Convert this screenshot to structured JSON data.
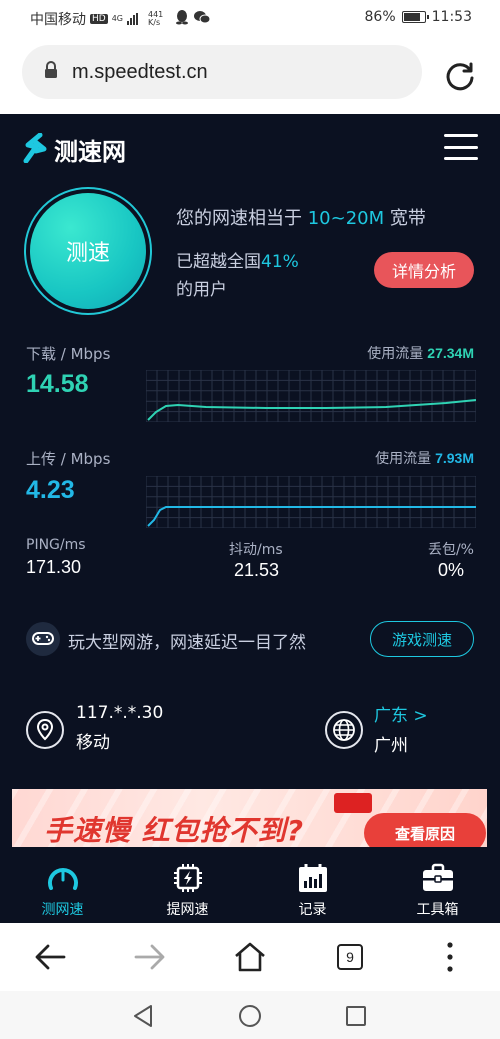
{
  "status_bar": {
    "carrier": "中国移动",
    "hd": "HD",
    "network": "4G",
    "speed_value": "441",
    "speed_unit": "K/s",
    "battery": "86%",
    "battery_level": 0.86,
    "time": "11:53"
  },
  "browser": {
    "url": "m.speedtest.cn",
    "tab_count": "9"
  },
  "app": {
    "logo": "测速网",
    "speed_button": "测速",
    "summary_prefix": "您的网速相当于",
    "summary_range": "10~20M",
    "summary_suffix": "宽带",
    "beat_prefix": "已超越全国",
    "beat_percent": "41%",
    "beat_suffix": "的用户",
    "detail_button": "详情分析"
  },
  "download": {
    "label": "下载 / Mbps",
    "value": "14.58",
    "usage_label": "使用流量",
    "usage_value": "27.34M",
    "color": "#2fd3b4"
  },
  "upload": {
    "label": "上传 / Mbps",
    "value": "4.23",
    "usage_label": "使用流量",
    "usage_value": "7.93M",
    "color": "#22b8e6"
  },
  "stats": {
    "ping_label": "PING/ms",
    "ping_value": "171.30",
    "jitter_label": "抖动/ms",
    "jitter_value": "21.53",
    "loss_label": "丢包/%",
    "loss_value": "0%"
  },
  "game": {
    "text": "玩大型网游，网速延迟一目了然",
    "button": "游戏测速"
  },
  "location": {
    "ip": "117.*.*.30",
    "isp": "移动",
    "province": "广东 >",
    "city": "广州"
  },
  "banner": {
    "text": "手速慢 红包抢不到?",
    "button": "查看原因"
  },
  "nav": {
    "items": [
      {
        "label": "测网速",
        "icon": "speedometer-icon",
        "active": true
      },
      {
        "label": "提网速",
        "icon": "chip-icon",
        "active": false
      },
      {
        "label": "记录",
        "icon": "records-icon",
        "active": false
      },
      {
        "label": "工具箱",
        "icon": "toolbox-icon",
        "active": false
      }
    ]
  },
  "colors": {
    "background": "#0b1121",
    "accent": "#1ec8e0",
    "danger": "#e8555a"
  }
}
